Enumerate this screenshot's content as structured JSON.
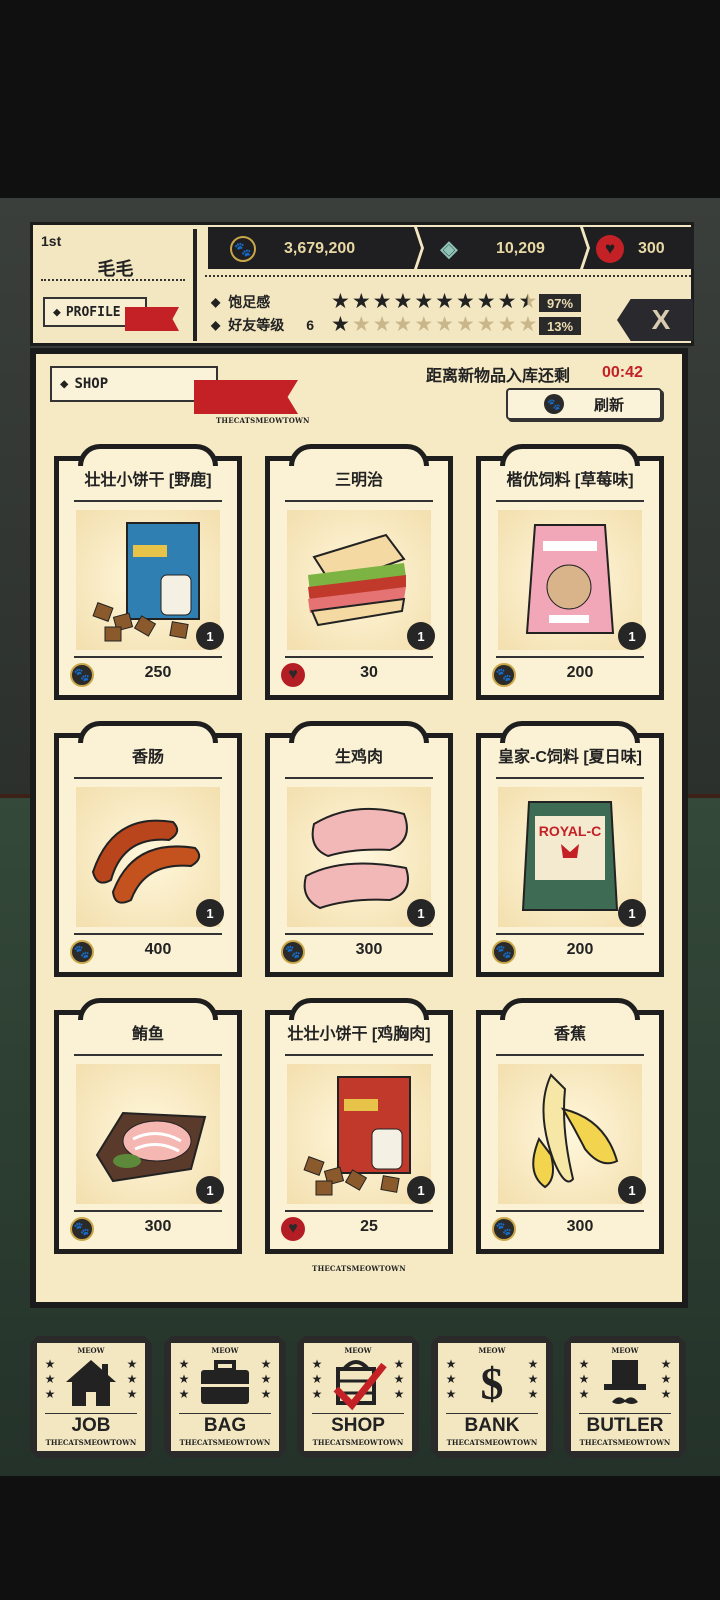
{
  "player": {
    "rank": "1st",
    "name": "毛毛",
    "profile_label": "PROFILE"
  },
  "currency": {
    "coins": {
      "icon": "paw-coin-icon",
      "value": "3,679,200"
    },
    "gems": {
      "icon": "diamond-icon",
      "value": "10,209"
    },
    "hearts": {
      "icon": "heart-icon",
      "value": "300"
    }
  },
  "stats": {
    "satiety": {
      "label": "饱足感",
      "percent": "97%",
      "stars_filled": 9.5,
      "stars_total": 10
    },
    "friendship": {
      "label": "好友等级",
      "level": "6",
      "percent": "13%",
      "stars_filled": 1,
      "stars_total": 10
    }
  },
  "close_label": "X",
  "shop": {
    "tag_label": "SHOP",
    "brand": "THECATSMEOWTOWN",
    "restock_label": "距离新物品入库还剩",
    "timer": "00:42",
    "refresh_label": "刷新",
    "items": [
      {
        "name": "壮壮小饼干 [野鹿]",
        "qty": "1",
        "price": "250",
        "currency": "coin",
        "icon": "cat-treat-box-icon"
      },
      {
        "name": "三明治",
        "qty": "1",
        "price": "30",
        "currency": "heart",
        "icon": "sandwich-icon"
      },
      {
        "name": "楷优饲料 [草莓味]",
        "qty": "1",
        "price": "200",
        "currency": "coin",
        "icon": "cat-food-bag-icon"
      },
      {
        "name": "香肠",
        "qty": "1",
        "price": "400",
        "currency": "coin",
        "icon": "sausage-icon"
      },
      {
        "name": "生鸡肉",
        "qty": "1",
        "price": "300",
        "currency": "coin",
        "icon": "raw-chicken-icon"
      },
      {
        "name": "皇家-C饲料 [夏日味]",
        "qty": "1",
        "price": "200",
        "currency": "coin",
        "icon": "royal-food-bag-icon"
      },
      {
        "name": "鲔鱼",
        "qty": "1",
        "price": "300",
        "currency": "coin",
        "icon": "tuna-icon"
      },
      {
        "name": "壮壮小饼干 [鸡胸肉]",
        "qty": "1",
        "price": "25",
        "currency": "heart",
        "icon": "cat-treat-box-icon"
      },
      {
        "name": "香蕉",
        "qty": "1",
        "price": "300",
        "currency": "coin",
        "icon": "banana-icon"
      }
    ]
  },
  "nav": [
    {
      "label": "JOB",
      "icon": "house-icon"
    },
    {
      "label": "BAG",
      "icon": "briefcase-icon"
    },
    {
      "label": "SHOP",
      "icon": "basket-check-icon"
    },
    {
      "label": "BANK",
      "icon": "dollar-icon"
    },
    {
      "label": "BUTLER",
      "icon": "top-hat-icon"
    }
  ],
  "nav_meow": "MEOW",
  "nav_brand": "THECATSMEOWTOWN",
  "colors": {
    "accent_red": "#c42127",
    "panel_cream": "#f6eac5",
    "dark": "#1e1e1e",
    "gold": "#c9a749"
  }
}
